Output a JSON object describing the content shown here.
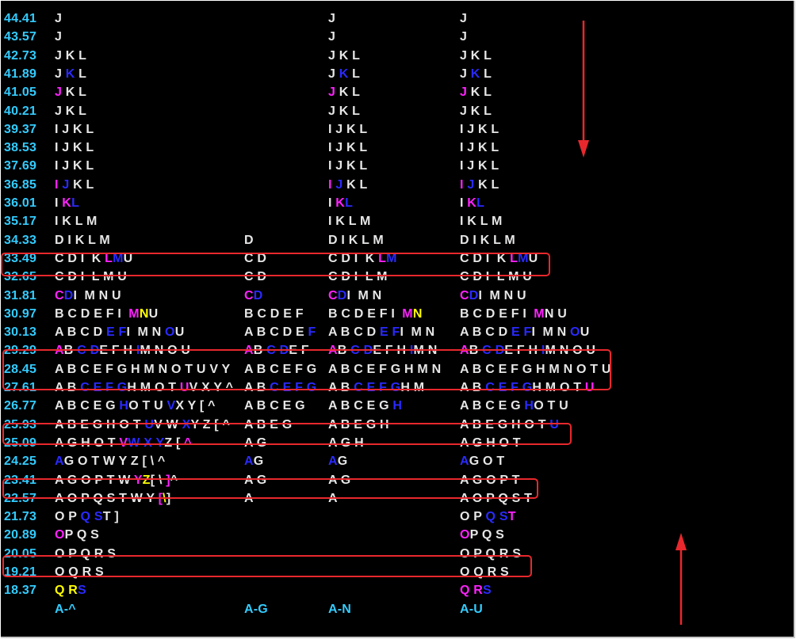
{
  "colors": {
    "w": "#e6e6e6",
    "b": "#2a2aff",
    "m": "#ff22ff",
    "y": "#ffff00",
    "cy": "#33ccff",
    "highlight": "#e8282d"
  },
  "rows": [
    {
      "price": "44.41",
      "cols": [
        [
          [
            "w",
            "J"
          ]
        ],
        [],
        [
          [
            "w",
            "J"
          ]
        ],
        [
          [
            "w",
            "J"
          ]
        ]
      ]
    },
    {
      "price": "43.57",
      "cols": [
        [
          [
            "w",
            "J"
          ]
        ],
        [],
        [
          [
            "w",
            "J"
          ]
        ],
        [
          [
            "w",
            "J"
          ]
        ]
      ]
    },
    {
      "price": "42.73",
      "cols": [
        [
          [
            "w",
            "J K L"
          ]
        ],
        [],
        [
          [
            "w",
            "J K L"
          ]
        ],
        [
          [
            "w",
            "J K L"
          ]
        ]
      ]
    },
    {
      "price": "41.89",
      "cols": [
        [
          [
            "w",
            "J "
          ],
          [
            "b",
            "K"
          ],
          [
            "w",
            " L"
          ]
        ],
        [],
        [
          [
            "w",
            "J "
          ],
          [
            "b",
            "K"
          ],
          [
            "w",
            " L"
          ]
        ],
        [
          [
            "w",
            "J "
          ],
          [
            "b",
            "K"
          ],
          [
            "w",
            " L"
          ]
        ]
      ]
    },
    {
      "price": "41.05",
      "cols": [
        [
          [
            "m",
            "J"
          ],
          [
            "w",
            " K L"
          ]
        ],
        [],
        [
          [
            "m",
            "J"
          ],
          [
            "w",
            " K L"
          ]
        ],
        [
          [
            "m",
            "J"
          ],
          [
            "w",
            " K L"
          ]
        ]
      ]
    },
    {
      "price": "40.21",
      "cols": [
        [
          [
            "w",
            "J K L"
          ]
        ],
        [],
        [
          [
            "w",
            "J K L"
          ]
        ],
        [
          [
            "w",
            "J K L"
          ]
        ]
      ]
    },
    {
      "price": "39.37",
      "cols": [
        [
          [
            "w",
            "I J K L"
          ]
        ],
        [],
        [
          [
            "w",
            "I J K L"
          ]
        ],
        [
          [
            "w",
            "I J K L"
          ]
        ]
      ]
    },
    {
      "price": "38.53",
      "cols": [
        [
          [
            "w",
            "I J K L"
          ]
        ],
        [],
        [
          [
            "w",
            "I J K L"
          ]
        ],
        [
          [
            "w",
            "I J K L"
          ]
        ]
      ]
    },
    {
      "price": "37.69",
      "cols": [
        [
          [
            "w",
            "I J K L"
          ]
        ],
        [],
        [
          [
            "w",
            "I J K L"
          ]
        ],
        [
          [
            "w",
            "I J K L"
          ]
        ]
      ]
    },
    {
      "price": "36.85",
      "cols": [
        [
          [
            "m",
            "I"
          ],
          [
            "w",
            " "
          ],
          [
            "b",
            "J"
          ],
          [
            "w",
            " K L"
          ]
        ],
        [],
        [
          [
            "m",
            "I"
          ],
          [
            "w",
            " "
          ],
          [
            "b",
            "J"
          ],
          [
            "w",
            " K L"
          ]
        ],
        [
          [
            "m",
            "I"
          ],
          [
            "w",
            " "
          ],
          [
            "b",
            "J"
          ],
          [
            "w",
            " K L"
          ]
        ]
      ]
    },
    {
      "price": "36.01",
      "cols": [
        [
          [
            "w",
            "I "
          ],
          [
            "m",
            "K"
          ],
          [
            "b",
            "L"
          ]
        ],
        [],
        [
          [
            "w",
            "I "
          ],
          [
            "m",
            "K"
          ],
          [
            "b",
            "L"
          ]
        ],
        [
          [
            "w",
            "I "
          ],
          [
            "m",
            "K"
          ],
          [
            "b",
            "L"
          ]
        ]
      ]
    },
    {
      "price": "35.17",
      "cols": [
        [
          [
            "w",
            "I K L M"
          ]
        ],
        [],
        [
          [
            "w",
            "I K L M"
          ]
        ],
        [
          [
            "w",
            "I K L M"
          ]
        ]
      ]
    },
    {
      "price": "34.33",
      "cols": [
        [
          [
            "w",
            "D I K L M"
          ]
        ],
        [
          [
            "w",
            "D"
          ]
        ],
        [
          [
            "w",
            "D I K L M"
          ]
        ],
        [
          [
            "w",
            "D I K L M"
          ]
        ]
      ]
    },
    {
      "price": "33.49",
      "cols": [
        [
          [
            "w",
            "C D I  K "
          ],
          [
            "m",
            "L"
          ],
          [
            "b",
            "M"
          ],
          [
            "w",
            "U"
          ]
        ],
        [
          [
            "w",
            "C D"
          ]
        ],
        [
          [
            "w",
            "C D I  K "
          ],
          [
            "m",
            "L"
          ],
          [
            "b",
            "M"
          ]
        ],
        [
          [
            "w",
            "C D I  K "
          ],
          [
            "m",
            "L"
          ],
          [
            "b",
            "M"
          ],
          [
            "w",
            "U"
          ]
        ]
      ]
    },
    {
      "price": "32.65",
      "cols": [
        [
          [
            "w",
            "C D I  L M U"
          ]
        ],
        [
          [
            "w",
            "C D"
          ]
        ],
        [
          [
            "w",
            "C D I  L M"
          ]
        ],
        [
          [
            "w",
            "C D I  L M U"
          ]
        ]
      ]
    },
    {
      "price": "31.81",
      "cols": [
        [
          [
            "m",
            "C"
          ],
          [
            "b",
            "D"
          ],
          [
            "w",
            "I  M N U"
          ]
        ],
        [
          [
            "m",
            "C"
          ],
          [
            "b",
            "D"
          ]
        ],
        [
          [
            "m",
            "C"
          ],
          [
            "b",
            "D"
          ],
          [
            "w",
            "I  M N"
          ]
        ],
        [
          [
            "m",
            "C"
          ],
          [
            "b",
            "D"
          ],
          [
            "w",
            "I  M N U"
          ]
        ]
      ]
    },
    {
      "price": "30.97",
      "cols": [
        [
          [
            "w",
            "B C D E F I  "
          ],
          [
            "m",
            "M"
          ],
          [
            "y",
            "N"
          ],
          [
            "w",
            "U"
          ]
        ],
        [
          [
            "w",
            "B C D E F"
          ]
        ],
        [
          [
            "w",
            "B C D E F I  "
          ],
          [
            "m",
            "M"
          ],
          [
            "y",
            "N"
          ]
        ],
        [
          [
            "w",
            "B C D E F I  "
          ],
          [
            "m",
            "M"
          ],
          [
            "w",
            "N U"
          ]
        ]
      ]
    },
    {
      "price": "30.13",
      "cols": [
        [
          [
            "w",
            "A B C D "
          ],
          [
            "b",
            "E F"
          ],
          [
            "w",
            "I  M N "
          ],
          [
            "b",
            "O"
          ],
          [
            "w",
            "U"
          ]
        ],
        [
          [
            "w",
            "A B C D E "
          ],
          [
            "b",
            "F"
          ]
        ],
        [
          [
            "w",
            "A B C D "
          ],
          [
            "b",
            "E F"
          ],
          [
            "w",
            "I  M N"
          ]
        ],
        [
          [
            "w",
            "A B C D "
          ],
          [
            "b",
            "E F"
          ],
          [
            "w",
            "I  M N "
          ],
          [
            "b",
            "O"
          ],
          [
            "w",
            "U"
          ]
        ]
      ]
    },
    {
      "price": "29.29",
      "cols": [
        [
          [
            "m",
            "A"
          ],
          [
            "w",
            "B "
          ],
          [
            "b",
            "C D"
          ],
          [
            "w",
            "E F H "
          ],
          [
            "b",
            "I"
          ],
          [
            "w",
            "M N O U"
          ]
        ],
        [
          [
            "m",
            "A"
          ],
          [
            "w",
            "B "
          ],
          [
            "b",
            "C D"
          ],
          [
            "w",
            "E F"
          ]
        ],
        [
          [
            "m",
            "A"
          ],
          [
            "w",
            "B "
          ],
          [
            "b",
            "C D"
          ],
          [
            "w",
            "E F H "
          ],
          [
            "b",
            "I"
          ],
          [
            "w",
            "M N"
          ]
        ],
        [
          [
            "m",
            "A"
          ],
          [
            "w",
            "B "
          ],
          [
            "b",
            "C D"
          ],
          [
            "w",
            "E F H "
          ],
          [
            "b",
            "I"
          ],
          [
            "w",
            "M N O U"
          ]
        ]
      ]
    },
    {
      "price": "28.45",
      "cols": [
        [
          [
            "w",
            "A B C E F G H M N O T U V Y"
          ]
        ],
        [
          [
            "w",
            "A B C E F G"
          ]
        ],
        [
          [
            "w",
            "A B C E F G H M N"
          ]
        ],
        [
          [
            "w",
            "A B C E F G H M N O T U"
          ]
        ]
      ]
    },
    {
      "price": "27.61",
      "cols": [
        [
          [
            "w",
            "A B "
          ],
          [
            "b",
            "C E F G"
          ],
          [
            "w",
            "H M O T "
          ],
          [
            "m",
            "U"
          ],
          [
            "w",
            "V X Y ^"
          ]
        ],
        [
          [
            "w",
            "A B "
          ],
          [
            "b",
            "C E F G"
          ]
        ],
        [
          [
            "w",
            "A B "
          ],
          [
            "b",
            "C E F G"
          ],
          [
            "w",
            "H M"
          ]
        ],
        [
          [
            "w",
            "A B "
          ],
          [
            "b",
            "C E F G"
          ],
          [
            "w",
            "H M O T "
          ],
          [
            "m",
            "U"
          ]
        ]
      ]
    },
    {
      "price": "26.77",
      "cols": [
        [
          [
            "w",
            "A B C E G "
          ],
          [
            "b",
            "H"
          ],
          [
            "w",
            "O T U "
          ],
          [
            "b",
            "V"
          ],
          [
            "w",
            "X Y [ ^"
          ]
        ],
        [
          [
            "w",
            "A B C E G"
          ]
        ],
        [
          [
            "w",
            "A B C E G "
          ],
          [
            "b",
            "H"
          ]
        ],
        [
          [
            "w",
            "A B C E G "
          ],
          [
            "b",
            "H"
          ],
          [
            "w",
            "O T U"
          ]
        ]
      ]
    },
    {
      "price": "25.93",
      "cols": [
        [
          [
            "w",
            "A B E G H O T "
          ],
          [
            "b",
            "U"
          ],
          [
            "w",
            "V W "
          ],
          [
            "b",
            "X"
          ],
          [
            "w",
            "Y Z [ ^"
          ]
        ],
        [
          [
            "w",
            "A B E G"
          ]
        ],
        [
          [
            "w",
            "A B E G H"
          ]
        ],
        [
          [
            "w",
            "A B E G H O T "
          ],
          [
            "b",
            "U"
          ]
        ]
      ]
    },
    {
      "price": "25.09",
      "cols": [
        [
          [
            "w",
            "A G H O T "
          ],
          [
            "m",
            "V"
          ],
          [
            "b",
            "W X Y"
          ],
          [
            "w",
            "Z [ "
          ],
          [
            "m",
            "^"
          ]
        ],
        [
          [
            "w",
            "A G"
          ]
        ],
        [
          [
            "w",
            "A G H"
          ]
        ],
        [
          [
            "w",
            "A G H O T"
          ]
        ]
      ]
    },
    {
      "price": "24.25",
      "cols": [
        [
          [
            "b",
            "A"
          ],
          [
            "w",
            "G O T W Y Z [ \\ ^"
          ]
        ],
        [
          [
            "b",
            "A"
          ],
          [
            "w",
            "G"
          ]
        ],
        [
          [
            "b",
            "A"
          ],
          [
            "w",
            "G"
          ]
        ],
        [
          [
            "b",
            "A"
          ],
          [
            "w",
            "G O T"
          ]
        ]
      ]
    },
    {
      "price": "23.41",
      "cols": [
        [
          [
            "w",
            "A G O P T W "
          ],
          [
            "m",
            "Y"
          ],
          [
            "y",
            "Z"
          ],
          [
            "w",
            "[ \\ "
          ],
          [
            "m",
            "]"
          ],
          [
            "w",
            "^"
          ]
        ],
        [
          [
            "w",
            "A G"
          ]
        ],
        [
          [
            "w",
            "A G"
          ]
        ],
        [
          [
            "w",
            "A G O P T"
          ]
        ]
      ]
    },
    {
      "price": "22.57",
      "cols": [
        [
          [
            "w",
            "A O P Q S T W Y "
          ],
          [
            "m",
            "["
          ],
          [
            "y",
            "\\"
          ],
          [
            "w",
            "]"
          ]
        ],
        [
          [
            "w",
            "A"
          ]
        ],
        [
          [
            "w",
            "A"
          ]
        ],
        [
          [
            "w",
            "A O P Q S T"
          ]
        ]
      ]
    },
    {
      "price": "21.73",
      "cols": [
        [
          [
            "w",
            "O P "
          ],
          [
            "b",
            "Q S"
          ],
          [
            "w",
            "T ]"
          ]
        ],
        [],
        [],
        [
          [
            "w",
            "O P "
          ],
          [
            "b",
            "Q S"
          ],
          [
            "m",
            "T"
          ]
        ]
      ]
    },
    {
      "price": "20.89",
      "cols": [
        [
          [
            "m",
            "O"
          ],
          [
            "w",
            "P Q S"
          ]
        ],
        [],
        [],
        [
          [
            "m",
            "O"
          ],
          [
            "w",
            "P Q S"
          ]
        ]
      ]
    },
    {
      "price": "20.05",
      "cols": [
        [
          [
            "w",
            "O P Q R S"
          ]
        ],
        [],
        [],
        [
          [
            "w",
            "O P Q R S"
          ]
        ]
      ]
    },
    {
      "price": "19.21",
      "cols": [
        [
          [
            "w",
            "O Q R S"
          ]
        ],
        [],
        [],
        [
          [
            "w",
            "O Q R S"
          ]
        ]
      ]
    },
    {
      "price": "18.37",
      "cols": [
        [
          [
            "y",
            "Q R"
          ],
          [
            "b",
            "S"
          ]
        ],
        [],
        [],
        [
          [
            "m",
            "Q R"
          ],
          [
            "b",
            "S"
          ]
        ]
      ]
    }
  ],
  "footer": [
    "A-^",
    "A-G",
    "A-N",
    "A-U"
  ]
}
